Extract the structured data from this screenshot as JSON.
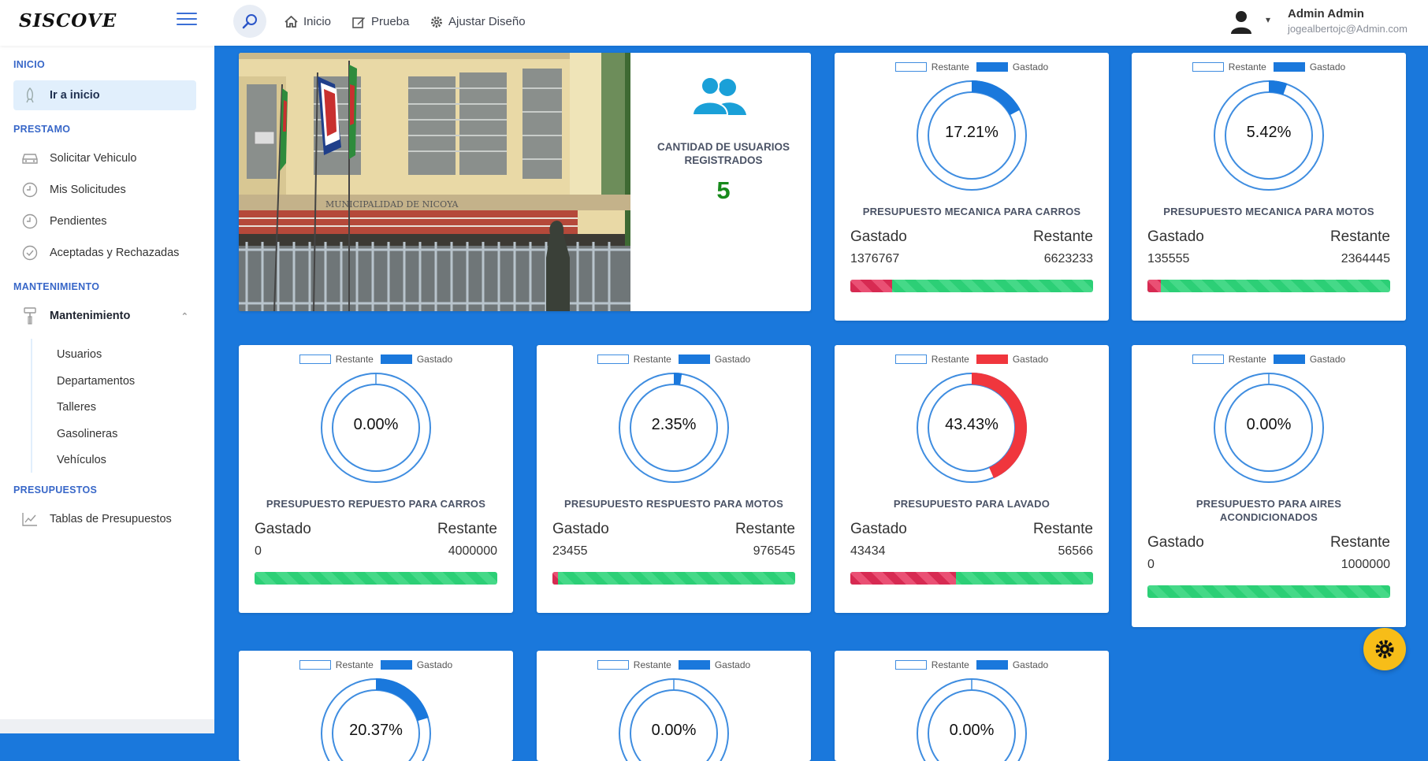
{
  "app": {
    "logo": "SISCOVE"
  },
  "nav": {
    "home": "Inicio",
    "test": "Prueba",
    "design": "Ajustar Diseño"
  },
  "user": {
    "name": "Admin Admin",
    "email": "jogealbertojc@Admin.com"
  },
  "sidebar": {
    "sec_inicio": "INICIO",
    "ir_inicio": "Ir a inicio",
    "sec_prestamo": "PRESTAMO",
    "solicitar": "Solicitar Vehiculo",
    "mis_solicitudes": "Mis Solicitudes",
    "pendientes": "Pendientes",
    "aceptadas": "Aceptadas y Rechazadas",
    "sec_mantenimiento": "MANTENIMIENTO",
    "mantenimiento": "Mantenimiento",
    "sub": [
      "Usuarios",
      "Departamentos",
      "Talleres",
      "Gasolineras",
      "Vehículos"
    ],
    "sec_presupuestos": "PRESUPUESTOS",
    "tablas": "Tablas de Presupuestos"
  },
  "users_card": {
    "title": "CANTIDAD DE USUARIOS REGISTRADOS",
    "count": "5",
    "image_text": "MUNICIPALIDAD DE NICOYA"
  },
  "legend": {
    "remaining": "Restante",
    "spent": "Gastado"
  },
  "colors": {
    "accent": "#1a78dc",
    "spent_blue": "#1a78dc",
    "spent_red": "#f0363d",
    "bar_green": "#2ccf76",
    "bar_red": "#d72a52"
  },
  "budgets": [
    {
      "title": "PRESUPUESTO MECANICA PARA CARROS",
      "percent": "17.21%",
      "fraction": 0.1721,
      "spent_label": "Gastado",
      "remaining_label": "Restante",
      "spent": "1376767",
      "remaining": "6623233",
      "ring_color": "#1a78dc"
    },
    {
      "title": "PRESUPUESTO MECANICA PARA MOTOS",
      "percent": "5.42%",
      "fraction": 0.0542,
      "spent_label": "Gastado",
      "remaining_label": "Restante",
      "spent": "135555",
      "remaining": "2364445",
      "ring_color": "#1a78dc"
    },
    {
      "title": "PRESUPUESTO REPUESTO PARA CARROS",
      "percent": "0.00%",
      "fraction": 0,
      "spent_label": "Gastado",
      "remaining_label": "Restante",
      "spent": "0",
      "remaining": "4000000",
      "ring_color": "#1a78dc"
    },
    {
      "title": "PRESUPUESTO RESPUESTO PARA MOTOS",
      "percent": "2.35%",
      "fraction": 0.0235,
      "spent_label": "Gastado",
      "remaining_label": "Restante",
      "spent": "23455",
      "remaining": "976545",
      "ring_color": "#1a78dc"
    },
    {
      "title": "PRESUPUESTO PARA LAVADO",
      "percent": "43.43%",
      "fraction": 0.4343,
      "spent_label": "Gastado",
      "remaining_label": "Restante",
      "spent": "43434",
      "remaining": "56566",
      "ring_color": "#f0363d"
    },
    {
      "title": "PRESUPUESTO PARA AIRES ACONDICIONADOS",
      "percent": "0.00%",
      "fraction": 0,
      "spent_label": "Gastado",
      "remaining_label": "Restante",
      "spent": "0",
      "remaining": "1000000",
      "ring_color": "#1a78dc"
    },
    {
      "percent": "20.37%",
      "fraction": 0.2037,
      "ring_color": "#1a78dc"
    },
    {
      "percent": "0.00%",
      "fraction": 0,
      "ring_color": "#1a78dc"
    },
    {
      "percent": "0.00%",
      "fraction": 0,
      "ring_color": "#1a78dc"
    }
  ]
}
